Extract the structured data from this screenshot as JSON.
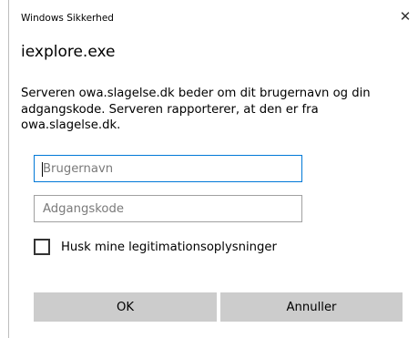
{
  "dialog": {
    "caption": "Windows Sikkerhed",
    "close_glyph": "✕",
    "app_title": "iexplore.exe",
    "message": "Serveren owa.slagelse.dk beder om dit brugernavn og din adgangskode. Serveren rapporterer, at den er fra owa.slagelse.dk."
  },
  "form": {
    "username": {
      "value": "",
      "placeholder": "Brugernavn"
    },
    "password": {
      "value": "",
      "placeholder": "Adgangskode"
    },
    "remember": {
      "label": "Husk mine legitimationsoplysninger",
      "checked": false
    }
  },
  "buttons": {
    "ok": "OK",
    "cancel": "Annuller"
  },
  "colors": {
    "focus_border": "#0078d7",
    "field_border": "#a0a0a0",
    "button_bg": "#cccccc"
  }
}
